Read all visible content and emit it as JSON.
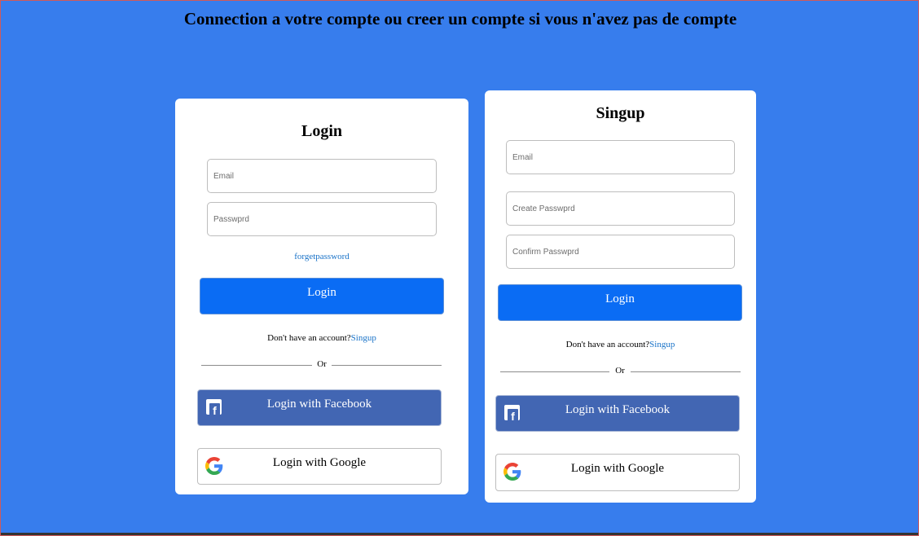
{
  "page": {
    "title": "Connection a votre compte ou creer un compte si vous n'avez pas de compte"
  },
  "login": {
    "title": "Login",
    "email_placeholder": "Email",
    "password_placeholder": "Passwprd",
    "forgot_link": "forgetpassword",
    "submit_label": "Login",
    "account_prompt": "Don't have an account?",
    "signup_link": "Singup",
    "divider_text": "Or",
    "facebook_label": "Login with Facebook",
    "google_label": "Login with Google"
  },
  "signup": {
    "title": "Singup",
    "email_placeholder": "Email",
    "create_password_placeholder": "Create Passwprd",
    "confirm_password_placeholder": "Confirm Passwprd",
    "submit_label": "Login",
    "account_prompt": "Don't have an account?",
    "signup_link": "Singup",
    "divider_text": "Or",
    "facebook_label": "Login with Facebook",
    "google_label": "Login with Google"
  },
  "icons": {
    "facebook": "facebook-icon",
    "google": "google-icon"
  },
  "colors": {
    "background": "#377ded",
    "primary_button": "#0a6cf4",
    "facebook_button": "#4266b3",
    "link": "#1a73c8"
  }
}
